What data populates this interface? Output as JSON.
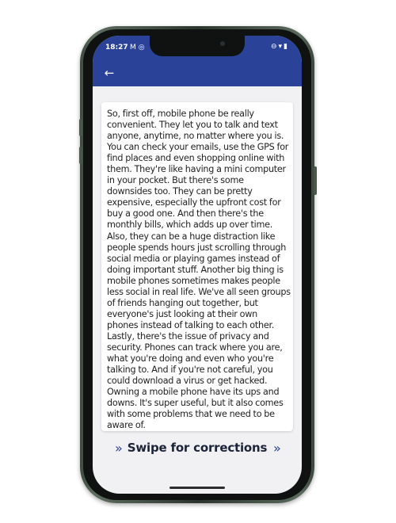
{
  "status_bar": {
    "time": "18:27",
    "left_icons": [
      "gmail-icon",
      "instagram-icon"
    ],
    "right_icons": [
      "dnd-icon",
      "wifi-icon",
      "battery-icon"
    ]
  },
  "app_bar": {
    "back_icon": "arrow-left-icon"
  },
  "card": {
    "text": "So, first off, mobile phone be really convenient. They let you to talk and text anyone, anytime, no matter where you is. You can check your emails, use the GPS for find places and even shopping online with them. They're like having a mini computer in your pocket. But there's some downsides too. They can be pretty expensive, especially the upfront cost for buy a good one. And then there's the monthly bills, which adds up over time. Also, they can be a huge distraction like people spends hours just scrolling through social media or playing games instead of doing important stuff. Another big thing is mobile phones sometimes makes people less social in real life. We've all seen groups of friends hanging out together, but everyone's just looking at their own phones instead of talking to each other. Lastly, there's the issue of privacy and security. Phones can track where you are, what you're doing and even who you're talking to. And if you're not careful, you could download a virus or get hacked. Owning a mobile phone have its ups and downs. It's super useful, but it also comes with some problems that we need to be aware of."
  },
  "swipe": {
    "label": "Swipe for corrections",
    "chevron_left": "»",
    "chevron_right": "»"
  },
  "colors": {
    "app_bar": "#2a4398",
    "screen_bg": "#f1f1f4",
    "phone_frame": "#3d4a3f"
  }
}
